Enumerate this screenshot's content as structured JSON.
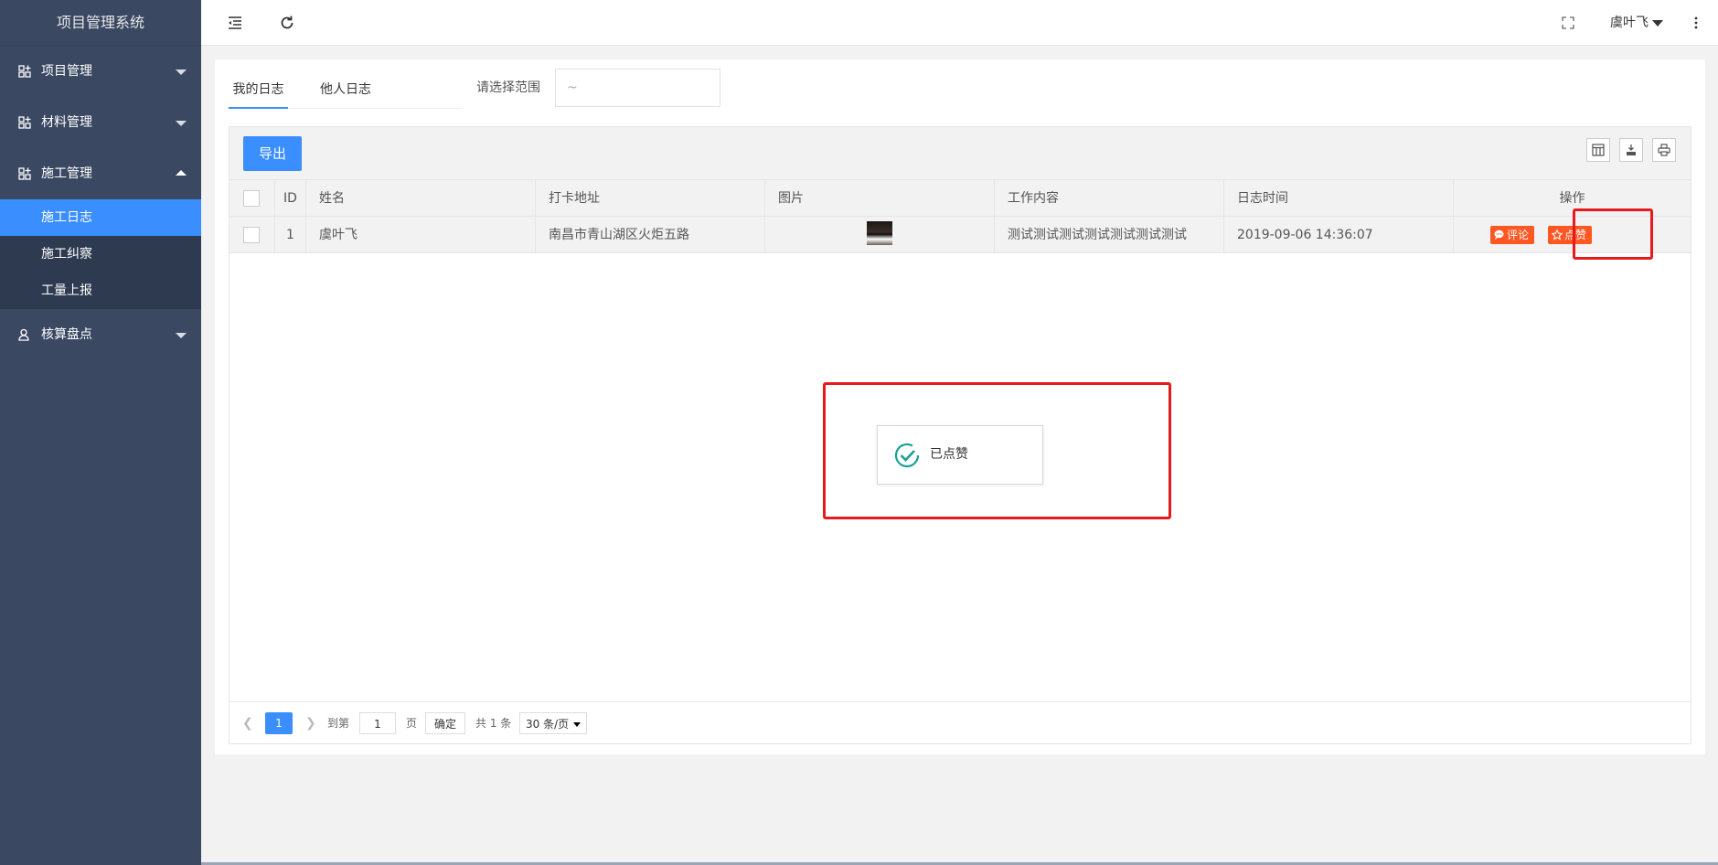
{
  "app": {
    "title": "项目管理系统"
  },
  "sidebar": {
    "items": [
      {
        "label": "项目管理",
        "icon": "grid-plus-icon",
        "expanded": false
      },
      {
        "label": "材料管理",
        "icon": "grid-plus-icon",
        "expanded": false
      },
      {
        "label": "施工管理",
        "icon": "grid-plus-icon",
        "expanded": true,
        "children": [
          {
            "label": "施工日志",
            "active": true
          },
          {
            "label": "施工纠察",
            "active": false
          },
          {
            "label": "工量上报",
            "active": false
          }
        ]
      },
      {
        "label": "核算盘点",
        "icon": "user-icon",
        "expanded": false
      }
    ]
  },
  "header": {
    "user_name": "虞叶飞",
    "icons": [
      "menu-fold-icon",
      "refresh-icon",
      "fullscreen-icon",
      "more-vertical-icon"
    ]
  },
  "tabs": [
    {
      "label": "我的日志",
      "active": true
    },
    {
      "label": "他人日志",
      "active": false
    }
  ],
  "filter": {
    "range_label": "请选择范围",
    "range_value": "~"
  },
  "toolbar": {
    "export_label": "导出",
    "tools": [
      "columns-icon",
      "export-file-icon",
      "print-icon"
    ]
  },
  "table": {
    "columns": [
      "",
      "ID",
      "姓名",
      "打卡地址",
      "图片",
      "工作内容",
      "日志时间",
      "操作"
    ],
    "rows": [
      {
        "id": "1",
        "name": "虞叶飞",
        "address": "南昌市青山湖区火炬五路",
        "content": "测试测试测试测试测试测试测试",
        "time": "2019-09-06 14:36:07",
        "actions": {
          "comment": "评论",
          "like": "点赞"
        }
      }
    ]
  },
  "pager": {
    "current_page": "1",
    "goto_prefix": "到第",
    "goto_value": "1",
    "goto_suffix": "页",
    "confirm": "确定",
    "total": "共 1 条",
    "page_size": "30 条/页"
  },
  "toast": {
    "message": "已点赞",
    "status_color": "#1aa094"
  },
  "colors": {
    "primary": "#3b8efe",
    "danger": "#ff5722",
    "sidebar": "#3a4862",
    "highlight": "#e8191c"
  }
}
